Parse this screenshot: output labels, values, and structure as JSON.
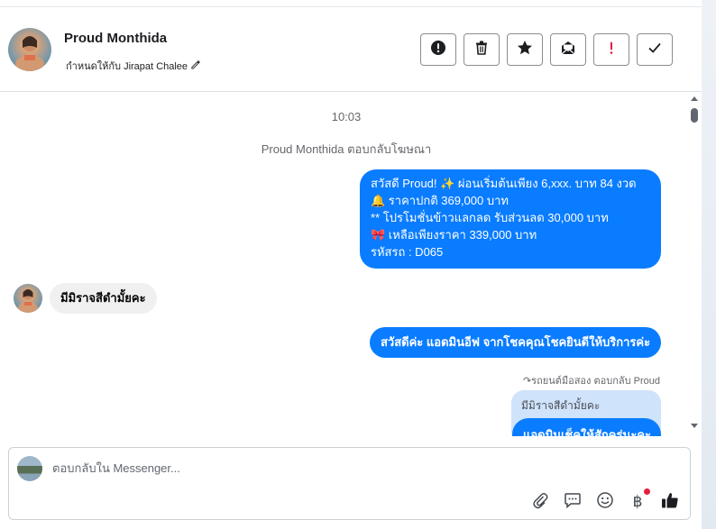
{
  "header": {
    "contact_name": "Proud Monthida",
    "assigned_label": "กำหนดให้กับ Jirapat Chalee",
    "actions": [
      {
        "name": "spam-button",
        "icon": "alert-circle-icon"
      },
      {
        "name": "delete-button",
        "icon": "trash-icon"
      },
      {
        "name": "star-button",
        "icon": "star-icon"
      },
      {
        "name": "mark-unread-button",
        "icon": "envelope-icon"
      },
      {
        "name": "follow-up-button",
        "icon": "exclamation-icon"
      },
      {
        "name": "mark-done-button",
        "icon": "check-icon"
      }
    ]
  },
  "conversation": {
    "timestamp": "10:03",
    "ad_reply_note": "Proud Monthida ตอบกลับโฆษณา",
    "outgoing_ad_message": [
      "สวัสดี Proud! ✨  ผ่อนเริ่มต้นเพียง 6,xxx. บาท 84 งวด",
      "🔔 ราคาปกติ 369,000 บาท",
      "** โปรโมชั่นข้าวแลกลด รับส่วนลด 30,000 บาท",
      "🎀  เหลือเพียงราคา 339,000 บาท",
      " รหัสรถ : D065"
    ],
    "incoming_message": "มีมิราจสีดำมั้ยคะ",
    "outgoing_greeting": "สวัสดีค่ะ แอดมินอีฟ จากโชคคุณโชคยินดีให้บริการค่ะ",
    "replied_to_label": "↷รถยนต์มือสอง ตอบกลับ Proud",
    "quoted_message": "มีมิราจสีดำมั้ยคะ",
    "outgoing_reply_partial": "แอดมินเช็คให้สักครู่นะคะ"
  },
  "composer": {
    "placeholder": "ตอบกลับใน Messenger...",
    "icons": [
      "paperclip-icon",
      "saved-reply-icon",
      "emoji-icon",
      "baht-payment-icon",
      "thumbs-up-icon"
    ],
    "baht_symbol": "฿"
  },
  "colors": {
    "outgoing_bubble": "#0a7cff",
    "incoming_bubble": "#f0f0f0",
    "quoted_bubble": "#cfe3fb",
    "notification_dot": "#e41e3f"
  }
}
